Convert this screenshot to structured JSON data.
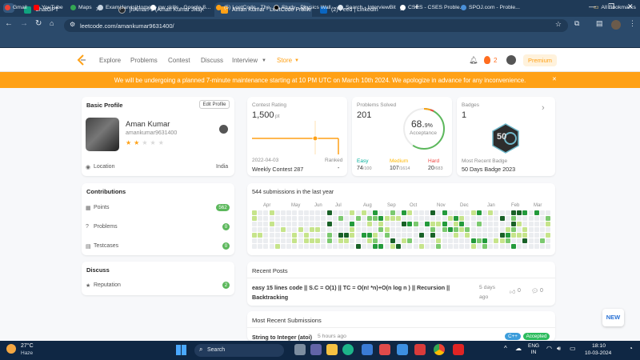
{
  "browser": {
    "tabs": [
      {
        "title": "ChatGPT",
        "color": "#10a37f"
      },
      {
        "title": "jhAman-9 (Aman Kumar Jha)",
        "color": "#24292e"
      },
      {
        "title": "Aman Kumar - LeetCode Profile",
        "color": "#ffa116"
      },
      {
        "title": "(2) Feed | LinkedIn",
        "color": "#0a66c2"
      }
    ],
    "url": "leetcode.com/amankumar9631400/",
    "bookmarks": [
      "Gmail",
      "YouTube",
      "Maps",
      "Exam|Jarvis|Home",
      "pw skills - Google S...",
      "(5) LeetCode - The...",
      "Study - Physics Wall...",
      "Search - InterviewBit",
      "CSES - CSES Proble...",
      "SPOJ.com - Proble...",
      "All Bookmarks"
    ]
  },
  "lc_nav": {
    "links": [
      "Explore",
      "Problems",
      "Contest",
      "Discuss",
      "Interview",
      "Store"
    ],
    "streak": "2",
    "premium": "Premium"
  },
  "banner": "We will be undergoing a planned 7-minute maintenance starting at 10 PM UTC on March 10th 2024. We apologize in advance for any inconvenience.",
  "profile": {
    "heading": "Basic Profile",
    "edit": "Edit Profile",
    "name": "Aman Kumar",
    "username": "amankumar9631400",
    "stars_filled": 2,
    "stars_total": 5,
    "location_label": "Location",
    "location_value": "India"
  },
  "contributions": {
    "heading": "Contributions",
    "rows": [
      {
        "label": "Points",
        "value": "562"
      },
      {
        "label": "Problems",
        "value": "0"
      },
      {
        "label": "Testcases",
        "value": "0"
      }
    ]
  },
  "discuss": {
    "heading": "Discuss",
    "rows": [
      {
        "label": "Reputation",
        "value": "2"
      }
    ]
  },
  "contest": {
    "label": "Contest Rating",
    "value": "1,500",
    "unit": "pt",
    "date": "2022-04-03",
    "name": "Weekly Contest 287",
    "ranked_label": "Ranked",
    "ranked_value": "-"
  },
  "solved": {
    "label": "Problems Solved",
    "value": "201",
    "percent": "68.",
    "percent_small": "9%",
    "acceptance": "Acceptance",
    "easy_label": "Easy",
    "easy": "74",
    "easy_total": "/100",
    "medium_label": "Medium",
    "medium": "107",
    "medium_total": "/1614",
    "hard_label": "Hard",
    "hard": "20",
    "hard_total": "/683",
    "acceptance_fraction": 0.689
  },
  "badges": {
    "label": "Badges",
    "count": "1",
    "recent_label": "Most Recent Badge",
    "recent_name": "50 Days Badge 2023",
    "badge_text": "50"
  },
  "heatmap": {
    "title": "544 submissions in the last year",
    "months": [
      "Apr",
      "May",
      "Jun",
      "Jul",
      "Aug",
      "Sep",
      "Oct",
      "Nov",
      "Dec",
      "Jan",
      "Feb",
      "Mar"
    ]
  },
  "posts": {
    "heading": "Recent Posts",
    "items": [
      {
        "title": "easy 15 lines code || S.C = O(1) || TC = O(n! *n)+O(n log n ) || Recursion || Backtracking",
        "ago": "5 days ago",
        "votes": "0",
        "comments": "0"
      }
    ]
  },
  "submissions": {
    "heading": "Most Recent Submissions",
    "items": [
      {
        "title": "String to Integer (atoi)",
        "ago": "5 hours ago",
        "lang": "C++",
        "status": "Accepted"
      }
    ]
  },
  "new_badge": "NEW",
  "taskbar": {
    "weather_temp": "27°C",
    "weather_desc": "Haze",
    "search": "Search",
    "lang1": "ENG",
    "lang2": "IN",
    "time": "18:10",
    "date": "10-03-2024"
  }
}
